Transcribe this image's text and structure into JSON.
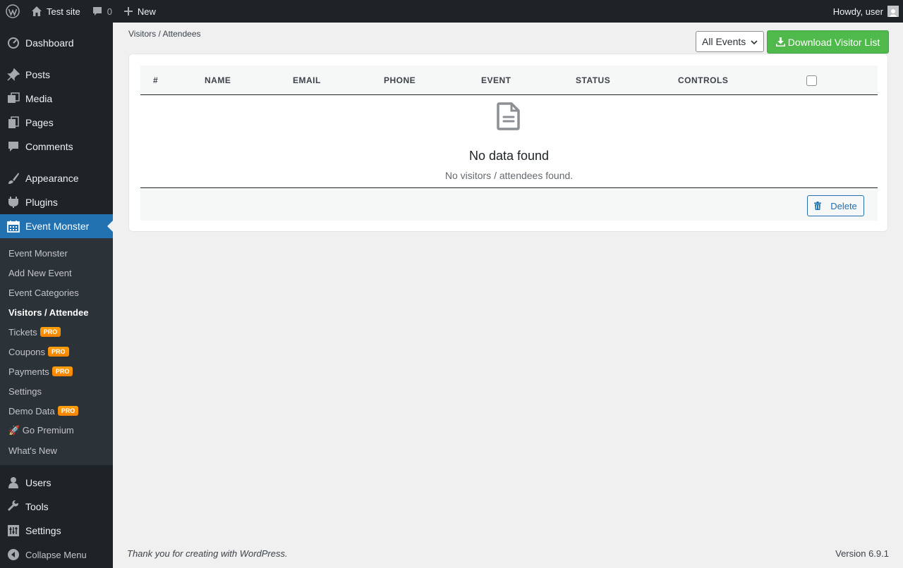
{
  "admin_bar": {
    "site_name": "Test site",
    "comments_count": "0",
    "new_label": "New",
    "howdy": "Howdy, user"
  },
  "sidebar": {
    "top_items": [
      {
        "label": "Dashboard",
        "icon": "dashboard-icon"
      },
      {
        "label": "Posts",
        "icon": "pushpin-icon"
      },
      {
        "label": "Media",
        "icon": "media-icon"
      },
      {
        "label": "Pages",
        "icon": "pages-icon"
      },
      {
        "label": "Comments",
        "icon": "comment-icon"
      },
      {
        "label": "Appearance",
        "icon": "paintbrush-icon"
      },
      {
        "label": "Plugins",
        "icon": "plugin-icon"
      },
      {
        "label": "Event Monster",
        "icon": "calendar-icon"
      }
    ],
    "submenu": [
      {
        "label": "Event Monster"
      },
      {
        "label": "Add New Event"
      },
      {
        "label": "Event Categories"
      },
      {
        "label": "Visitors / Attendee"
      },
      {
        "label": "Tickets",
        "badge": "PRO"
      },
      {
        "label": "Coupons",
        "badge": "PRO"
      },
      {
        "label": "Payments",
        "badge": "PRO"
      },
      {
        "label": "Settings"
      },
      {
        "label": "Demo Data",
        "badge": "PRO"
      },
      {
        "label": "🚀 Go Premium"
      },
      {
        "label": "What's New"
      }
    ],
    "bottom_items": [
      {
        "label": "Users",
        "icon": "user-icon"
      },
      {
        "label": "Tools",
        "icon": "wrench-icon"
      },
      {
        "label": "Settings",
        "icon": "settings-icon"
      },
      {
        "label": "Collapse Menu",
        "icon": "collapse-icon"
      }
    ]
  },
  "page": {
    "breadcrumb": "Visitors / Attendees",
    "event_filter": "All Events",
    "download_label": "Download Visitor List"
  },
  "table": {
    "columns": [
      "#",
      "NAME",
      "EMAIL",
      "PHONE",
      "EVENT",
      "STATUS",
      "CONTROLS"
    ],
    "empty_title": "No data found",
    "empty_message": "No visitors / attendees found.",
    "delete_label": "Delete"
  },
  "footer": {
    "thanks": "Thank you for creating with WordPress.",
    "version": "Version 6.9.1"
  },
  "colors": {
    "accent": "#2271b1",
    "download_button": "#4fb94b",
    "badge": "#f58300"
  }
}
